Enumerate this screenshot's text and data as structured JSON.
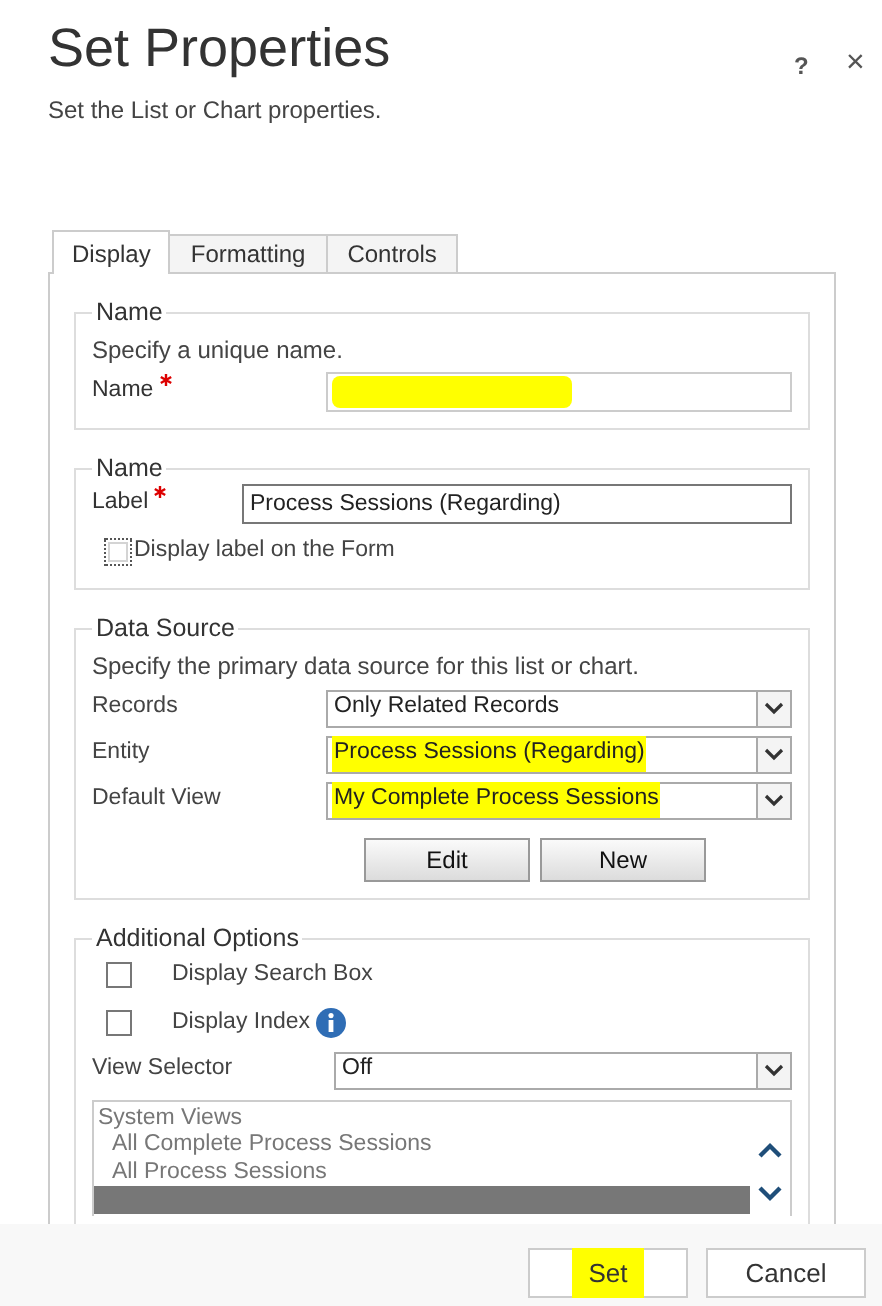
{
  "dialog": {
    "title": "Set Properties",
    "subtitle": "Set the List or Chart properties.",
    "help_button": "?",
    "close_button": "×"
  },
  "tabs": [
    {
      "label": "Display",
      "selected": true
    },
    {
      "label": "Formatting",
      "selected": false
    },
    {
      "label": "Controls",
      "selected": false
    }
  ],
  "sections": [
    {
      "kind": "name",
      "legend": "Name",
      "rows": [
        {
          "kind": "hint",
          "text": "Specify a unique name."
        },
        {
          "kind": "text",
          "label": "Name",
          "required": true,
          "highlighted": true
        }
      ]
    },
    {
      "kind": "label",
      "legend": "Name",
      "rows": [
        {
          "kind": "text",
          "label": "Label",
          "required": true,
          "value": "Process Sessions (Regarding)",
          "highlighted": false
        },
        {
          "kind": "checkbox",
          "label": "Display label on the Form",
          "checked": false,
          "focused": true
        }
      ]
    },
    {
      "kind": "data_source",
      "legend": "Data Source",
      "rows": [
        {
          "kind": "hint",
          "text": "Specify the primary data source for this list or chart."
        },
        {
          "kind": "select",
          "label": "Records",
          "value": "Only Related Records",
          "highlighted": false
        },
        {
          "kind": "select",
          "label": "Entity",
          "value": "Process Sessions (Regarding)",
          "highlighted": true
        },
        {
          "kind": "select",
          "label": "Default View",
          "value": "My Complete Process Sessions",
          "highlighted": true
        },
        {
          "kind": "buttons",
          "buttons": [
            "Edit",
            "New"
          ]
        }
      ]
    },
    {
      "kind": "additional",
      "legend": "Additional Options",
      "rows": [
        {
          "kind": "checkbox",
          "label": "Display Search Box",
          "checked": false,
          "focused": false
        },
        {
          "kind": "checkbox",
          "label": "Display Index",
          "checked": false,
          "focused": false,
          "info": true
        },
        {
          "kind": "select",
          "label": "View Selector",
          "value": "Off",
          "highlighted": false
        },
        {
          "kind": "listbox",
          "group": "System Views",
          "items": [
            {
              "label": "All Complete Process Sessions",
              "selected": false
            },
            {
              "label": "All Process Sessions",
              "selected": false
            },
            {
              "selected": true
            }
          ]
        }
      ]
    }
  ],
  "footer_buttons": [
    {
      "label": "Set",
      "highlighted": true
    },
    {
      "label": "Cancel",
      "highlighted": false
    }
  ]
}
